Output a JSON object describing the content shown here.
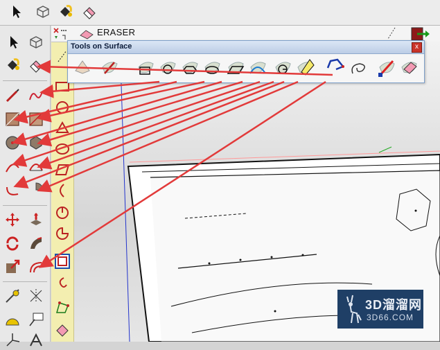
{
  "top_toolbar": {
    "tools": [
      {
        "name": "select-tool",
        "icon": "arrow-pointer-icon"
      },
      {
        "name": "component-tool",
        "icon": "component-box-icon"
      },
      {
        "name": "paint-bucket-tool",
        "icon": "paint-bucket-icon"
      },
      {
        "name": "eraser-tool",
        "icon": "eraser-icon"
      }
    ]
  },
  "left_toolbar": {
    "groups": [
      [
        "select",
        "component"
      ],
      [
        "paint",
        "eraser"
      ],
      [
        "line",
        "freehand"
      ],
      [
        "rectangle",
        "rotated-rectangle"
      ],
      [
        "circle",
        "polygon"
      ],
      [
        "arc",
        "2-point-arc"
      ],
      [
        "3-point-arc",
        "pie"
      ],
      [
        "move",
        "push-pull"
      ],
      [
        "rotate",
        "follow-me"
      ],
      [
        "scale",
        "offset"
      ],
      [
        "tape-measure",
        "text"
      ],
      [
        "protractor",
        "axes"
      ],
      [
        "dimension",
        "3d-text"
      ]
    ]
  },
  "eraser_bar": {
    "label": "ERASER"
  },
  "tools_on_surface": {
    "title": "Tools on Surface",
    "close_glyph": "x",
    "tools": [
      "erase-tool",
      "line-tool",
      "rectangle-tool",
      "circle-tool",
      "polygon-tool",
      "ellipse-tool",
      "parallelogram-tool",
      "arc-tool",
      "pie-tool",
      "offset-tool",
      "polyline-tool",
      "freehand-tool",
      "generate-faces-tool",
      "eraser-tool"
    ]
  },
  "watermark": {
    "title": "3D溜溜网",
    "url": "3D66.COM"
  },
  "colors": {
    "arrow": "#e23a3a",
    "panel_border": "#7d9fc9",
    "watermark_bg": "#1f3f66",
    "strip_yellow": "#f3eeb0"
  }
}
